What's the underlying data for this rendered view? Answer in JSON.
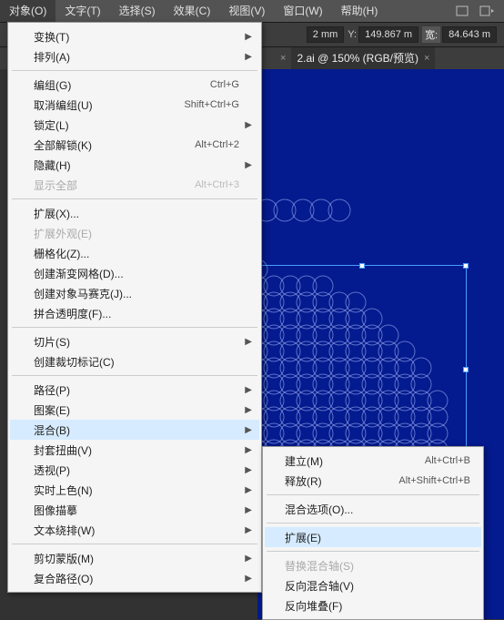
{
  "menubar": {
    "items": [
      "对象(O)",
      "文字(T)",
      "选择(S)",
      "效果(C)",
      "视图(V)",
      "窗口(W)",
      "帮助(H)"
    ]
  },
  "toolbar": {
    "unit1": "2 mm",
    "y_label": "Y:",
    "y_val": "149.867 m",
    "w_label": "宽:",
    "w_val": "84.643 m"
  },
  "tabs": {
    "tab2": "2.ai @ 150% (RGB/预览)"
  },
  "menu": {
    "transform": "变换(T)",
    "arrange": "排列(A)",
    "group": "编组(G)",
    "group_s": "Ctrl+G",
    "ungroup": "取消编组(U)",
    "ungroup_s": "Shift+Ctrl+G",
    "lock": "锁定(L)",
    "unlockAll": "全部解锁(K)",
    "unlockAll_s": "Alt+Ctrl+2",
    "hide": "隐藏(H)",
    "showAll": "显示全部",
    "showAll_s": "Alt+Ctrl+3",
    "expand": "扩展(X)...",
    "expandAppearance": "扩展外观(E)",
    "rasterize": "栅格化(Z)...",
    "gradientMesh": "创建渐变网格(D)...",
    "objectMosaic": "创建对象马赛克(J)...",
    "flattenTransparency": "拼合透明度(F)...",
    "slice": "切片(S)",
    "trimMarks": "创建裁切标记(C)",
    "path": "路径(P)",
    "pattern": "图案(E)",
    "blend": "混合(B)",
    "envelope": "封套扭曲(V)",
    "perspective": "透视(P)",
    "livePaint": "实时上色(N)",
    "imageTrace": "图像描摹",
    "textWrap": "文本绕排(W)",
    "clippingMask": "剪切蒙版(M)",
    "compoundPath": "复合路径(O)"
  },
  "submenu": {
    "make": "建立(M)",
    "make_s": "Alt+Ctrl+B",
    "release": "释放(R)",
    "release_s": "Alt+Shift+Ctrl+B",
    "options": "混合选项(O)...",
    "expand": "扩展(E)",
    "replaceSpine": "替换混合轴(S)",
    "reverseSpine": "反向混合轴(V)",
    "reverseFront": "反向堆叠(F)"
  },
  "chart_data": null
}
